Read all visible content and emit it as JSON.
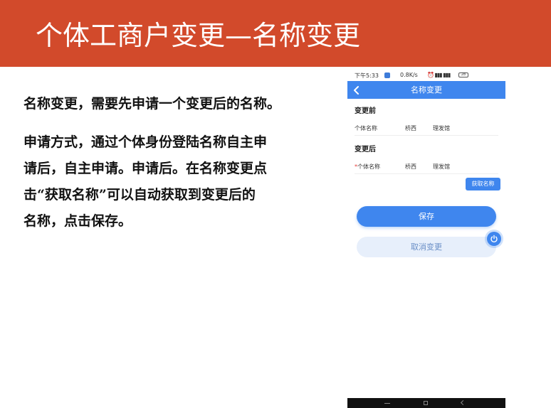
{
  "slide": {
    "title": "个体工商户变更—名称变更",
    "paragraph1": "名称变更，需要先申请一个变更后的名称。",
    "paragraph2_lines": [
      "申请方式，通过个体身份登陆名称自主申",
      "请后，自主申请。申请后。在名称变更点",
      "击“获取名称”可以自动获取到变更后的",
      "名称，点击保存。"
    ]
  },
  "phone": {
    "status": {
      "time": "下午5:33",
      "speed": "0.8K/s",
      "icons": "⏰ ▮▮▮ ▮▮▮",
      "battery": "28"
    },
    "nav_title": "名称变更",
    "before": {
      "heading": "变更前",
      "label": "个体名称",
      "value1": "桥西",
      "value2": "理发馆"
    },
    "after": {
      "heading": "变更后",
      "required": "*",
      "label": "个体名称",
      "value1": "桥西",
      "value2": "理发馆"
    },
    "fetch_label": "获取名称",
    "save_label": "保存",
    "cancel_label": "取消变更"
  },
  "colors": {
    "title_bar": "#d24a2b",
    "primary": "#3f86ee"
  }
}
